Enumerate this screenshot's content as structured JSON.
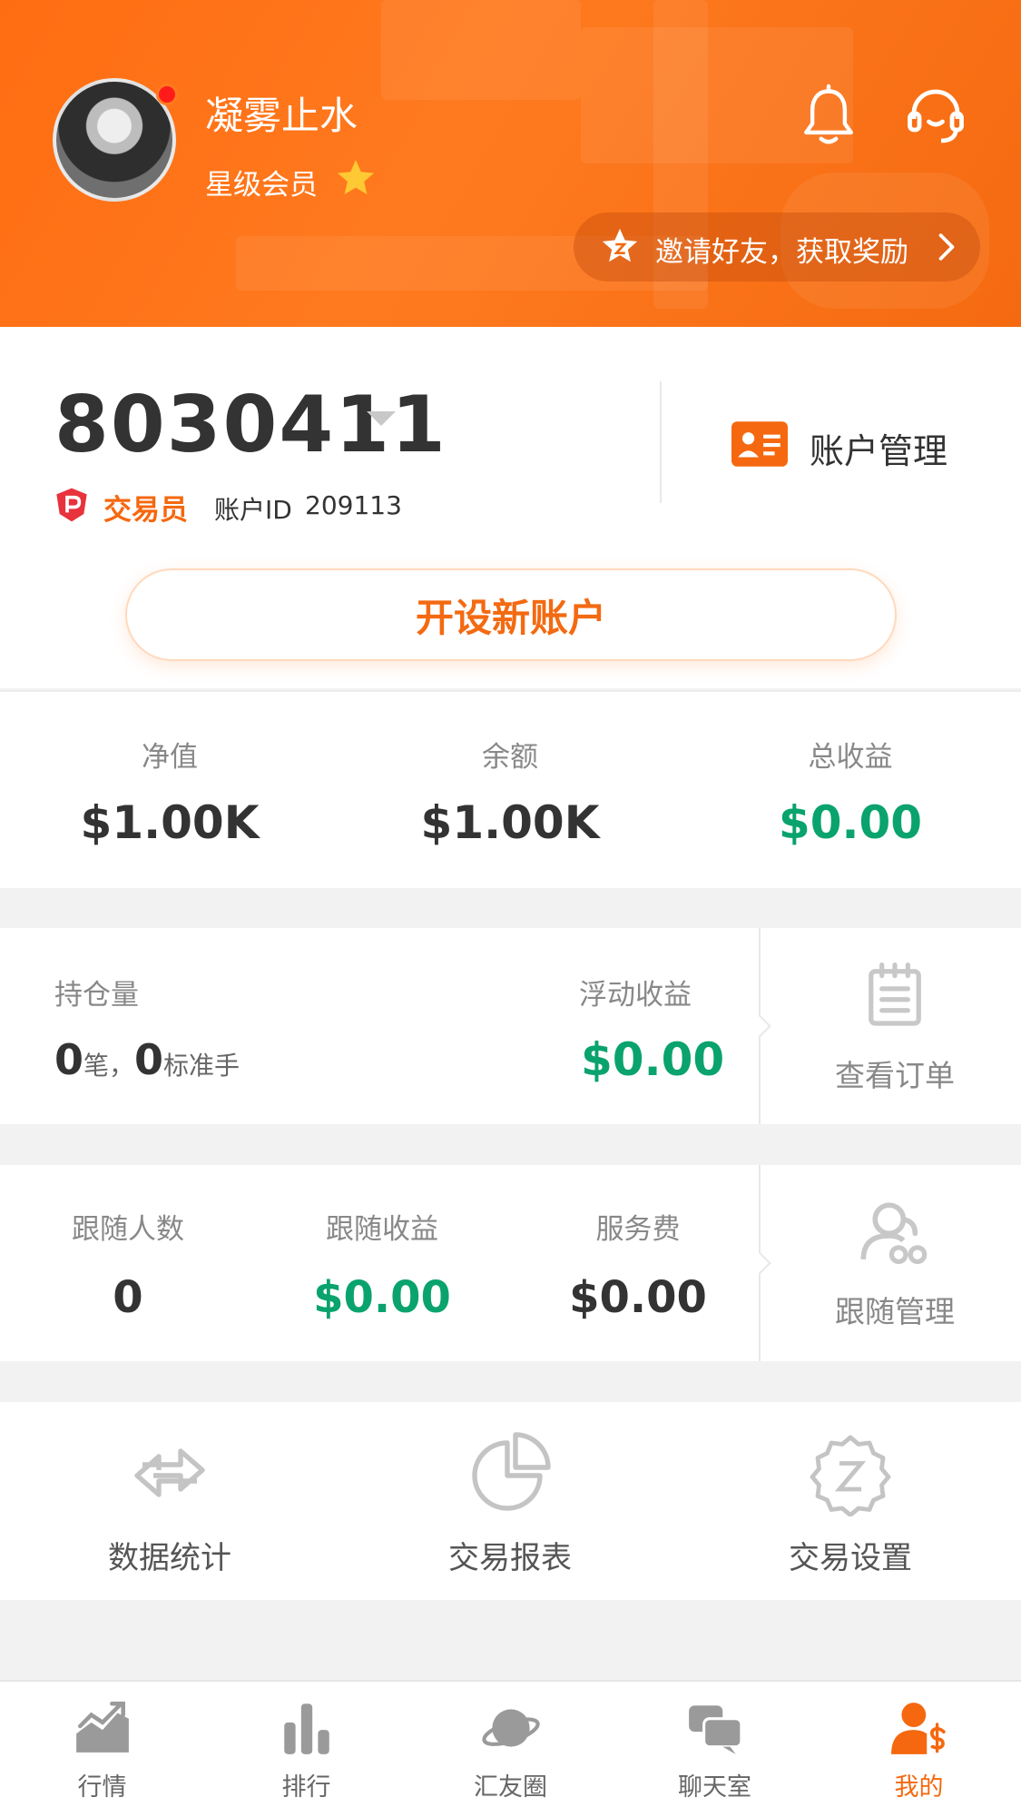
{
  "profile": {
    "username": "凝雾止水",
    "member_level": "星级会员",
    "invite_text": "邀请好友，获取奖励"
  },
  "account": {
    "number": "8030411",
    "manage_label": "账户管理",
    "role": "交易员",
    "id_label": "账户ID",
    "id_value": "209113",
    "open_new_label": "开设新账户"
  },
  "stats": [
    {
      "label": "净值",
      "value": "$1.00K",
      "color": "#333333"
    },
    {
      "label": "余额",
      "value": "$1.00K",
      "color": "#333333"
    },
    {
      "label": "总收益",
      "value": "$0.00",
      "color": "#0aa36d"
    }
  ],
  "positions": {
    "holding_label": "持仓量",
    "lots_count": "0",
    "lots_unit": "笔，",
    "std_count": "0",
    "std_unit": "标准手",
    "float_label": "浮动收益",
    "float_value": "$0.00",
    "orders_label": "查看订单"
  },
  "follow": {
    "items": [
      {
        "label": "跟随人数",
        "value": "0"
      },
      {
        "label": "跟随收益",
        "value": "$0.00"
      },
      {
        "label": "服务费",
        "value": "$0.00"
      }
    ],
    "manage_label": "跟随管理"
  },
  "tools": [
    {
      "label": "数据统计",
      "icon": "transfer-arrows-icon"
    },
    {
      "label": "交易报表",
      "icon": "pie-chart-icon"
    },
    {
      "label": "交易设置",
      "icon": "settings-gear-icon"
    }
  ],
  "tabs": [
    {
      "label": "行情",
      "icon": "trend-chart-icon",
      "active": false
    },
    {
      "label": "排行",
      "icon": "bar-chart-icon",
      "active": false
    },
    {
      "label": "汇友圈",
      "icon": "planet-icon",
      "active": false
    },
    {
      "label": "聊天室",
      "icon": "chat-icon",
      "active": false
    },
    {
      "label": "我的",
      "icon": "user-dollar-icon",
      "active": true
    }
  ],
  "colors": {
    "brand_orange": "#f5680f",
    "profit_green": "#0aa36d"
  }
}
